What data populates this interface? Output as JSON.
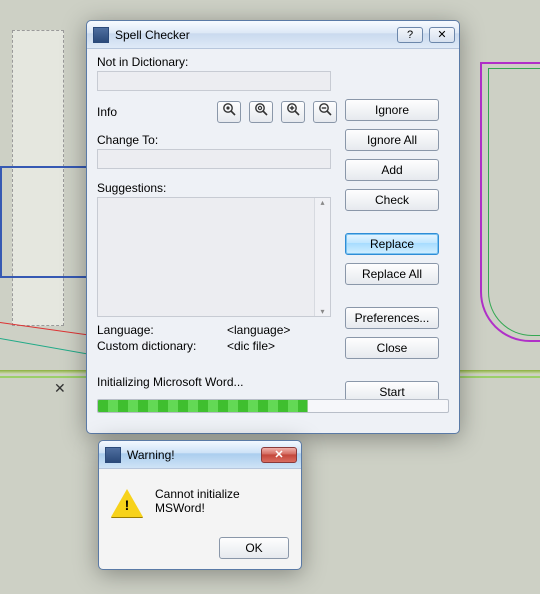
{
  "spell": {
    "title": "Spell Checker",
    "labels": {
      "not_in_dict": "Not in Dictionary:",
      "info": "Info",
      "change_to": "Change To:",
      "suggestions": "Suggestions:",
      "language": "Language:",
      "custom_dict": "Custom dictionary:"
    },
    "values": {
      "not_in_dict": "",
      "change_to": "",
      "language": "<language>",
      "custom_dict": "<dic file>"
    },
    "info_icons": {
      "a": "⦿",
      "b": "⦾",
      "c": "🔍+",
      "d": "🔍−"
    },
    "buttons": {
      "ignore": "Ignore",
      "ignore_all": "Ignore All",
      "add": "Add",
      "check": "Check",
      "replace": "Replace",
      "replace_all": "Replace All",
      "preferences": "Preferences...",
      "close": "Close",
      "start": "Start"
    },
    "status": "Initializing Microsoft Word...",
    "progress_pct": 60,
    "title_buttons": {
      "help": "?",
      "close": "✕"
    }
  },
  "warn": {
    "title": "Warning!",
    "message": "Cannot initialize MSWord!",
    "ok": "OK",
    "close_glyph": "✕"
  }
}
